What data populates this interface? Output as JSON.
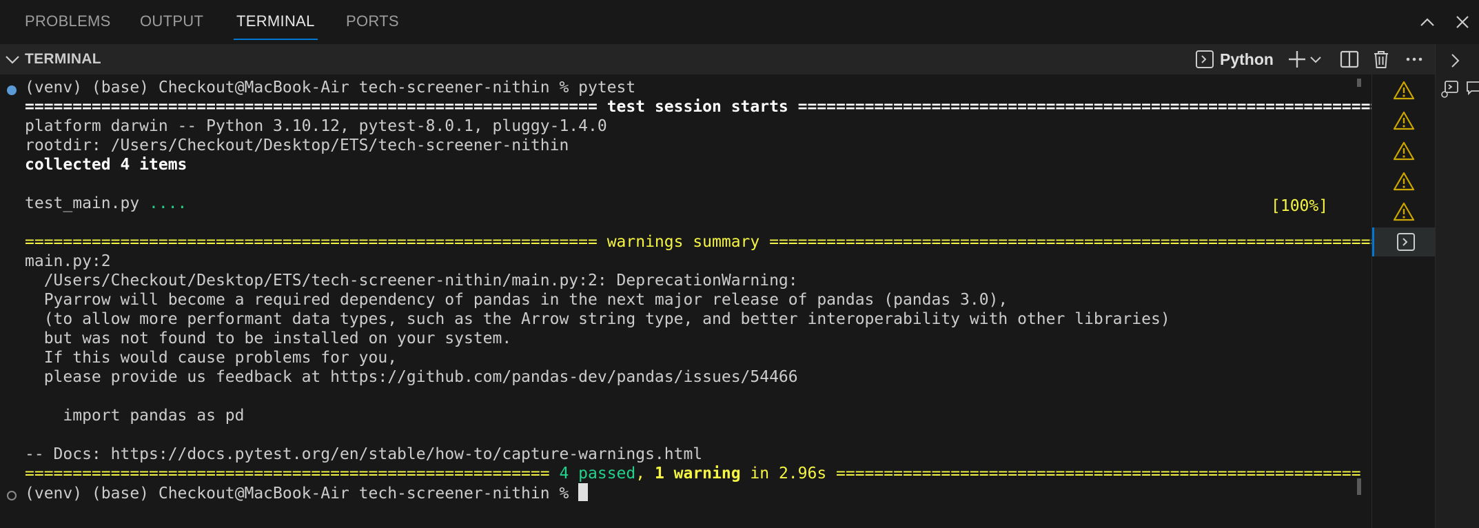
{
  "tabs": [
    {
      "label": "PROBLEMS"
    },
    {
      "label": "OUTPUT"
    },
    {
      "label": "TERMINAL",
      "active": true
    },
    {
      "label": "PORTS"
    }
  ],
  "panel_header": {
    "title": "TERMINAL",
    "profile_name": "Python"
  },
  "terminal": {
    "lines": [
      {
        "segments": [
          {
            "text": "(venv) (base) Checkout@MacBook-Air tech-screener-nithin % pytest"
          }
        ]
      },
      {
        "segments": [
          {
            "text": "============================================================ ",
            "style": "b"
          },
          {
            "text": "test session starts",
            "style": "b"
          },
          {
            "text": " ==================================================================",
            "style": "b"
          }
        ]
      },
      {
        "segments": [
          {
            "text": "platform darwin -- Python 3.10.12, pytest-8.0.1, pluggy-1.4.0"
          }
        ]
      },
      {
        "segments": [
          {
            "text": "rootdir: /Users/Checkout/Desktop/ETS/tech-screener-nithin"
          }
        ]
      },
      {
        "segments": [
          {
            "text": "collected 4 items",
            "style": "b"
          }
        ]
      },
      {
        "segments": [
          {
            "text": ""
          }
        ]
      },
      {
        "segments": [
          {
            "text": "test_main.py "
          },
          {
            "text": "....",
            "style": "g"
          }
        ]
      },
      {
        "segments": [
          {
            "text": ""
          }
        ]
      },
      {
        "segments": [
          {
            "text": "============================================================ ",
            "style": "y"
          },
          {
            "text": "warnings summary",
            "style": "y"
          },
          {
            "text": " ===================================================================",
            "style": "y"
          }
        ]
      },
      {
        "segments": [
          {
            "text": "main.py:2"
          }
        ]
      },
      {
        "segments": [
          {
            "text": "  /Users/Checkout/Desktop/ETS/tech-screener-nithin/main.py:2: DeprecationWarning:"
          }
        ]
      },
      {
        "segments": [
          {
            "text": "  Pyarrow will become a required dependency of pandas in the next major release of pandas (pandas 3.0),"
          }
        ]
      },
      {
        "segments": [
          {
            "text": "  (to allow more performant data types, such as the Arrow string type, and better interoperability with other libraries)"
          }
        ]
      },
      {
        "segments": [
          {
            "text": "  but was not found to be installed on your system."
          }
        ]
      },
      {
        "segments": [
          {
            "text": "  If this would cause problems for you,"
          }
        ]
      },
      {
        "segments": [
          {
            "text": "  please provide us feedback at https://github.com/pandas-dev/pandas/issues/54466"
          }
        ]
      },
      {
        "segments": [
          {
            "text": ""
          }
        ]
      },
      {
        "segments": [
          {
            "text": "    import pandas as pd"
          }
        ]
      },
      {
        "segments": [
          {
            "text": ""
          }
        ]
      },
      {
        "segments": [
          {
            "text": "-- Docs: https://docs.pytest.org/en/stable/how-to/capture-warnings.html"
          }
        ]
      },
      {
        "segments": [
          {
            "text": "======================================================= ",
            "style": "y"
          },
          {
            "text": "4 passed",
            "style": "g"
          },
          {
            "text": ", ",
            "style": "y"
          },
          {
            "text": "1 warning",
            "style": "gy"
          },
          {
            "text": " in 2.96s",
            "style": "y"
          },
          {
            "text": " =======================================================",
            "style": "y"
          }
        ]
      },
      {
        "segments": [
          {
            "text": "(venv) (base) Checkout@MacBook-Air tech-screener-nithin % "
          }
        ],
        "cursor": true
      }
    ],
    "progress_label": "[100%]"
  },
  "side_list": [
    {
      "icon": "warning-icon"
    },
    {
      "icon": "warning-icon"
    },
    {
      "icon": "warning-icon"
    },
    {
      "icon": "warning-icon"
    },
    {
      "icon": "warning-icon"
    },
    {
      "icon": "terminal-icon",
      "active": true
    }
  ],
  "colors": {
    "accent": "#0078d4",
    "warning": "#cca700",
    "pass_green": "#23d18b",
    "summary_yellow": "#f5f543"
  }
}
